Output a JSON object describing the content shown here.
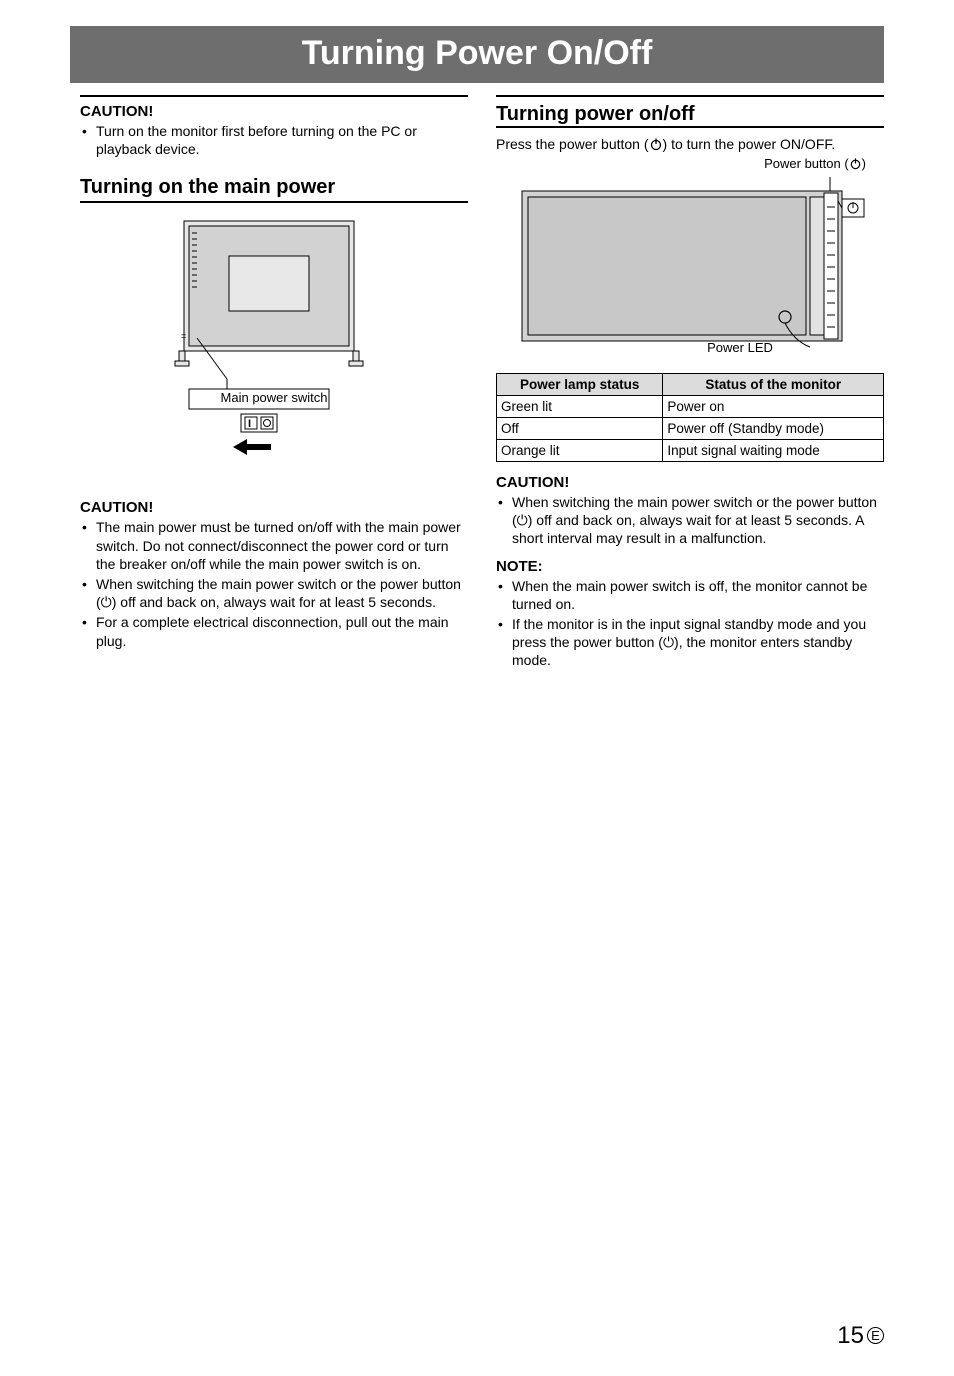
{
  "title": "Turning Power On/Off",
  "left": {
    "caution1_h": "CAUTION!",
    "caution1_items": [
      "Turn on the monitor first before turning on the PC or playback device."
    ],
    "section_h": "Turning on the main power",
    "fig_label": "Main power switch",
    "caution2_h": "CAUTION!",
    "caution2_items": [
      "The main power must be turned on/off with the main power switch. Do not connect/disconnect the power cord or turn the breaker on/off while the main power switch is on.",
      "When switching the main power switch or the power button (⏻) off and back on, always wait for at least 5 seconds.",
      "For a complete electrical disconnection, pull out the main plug."
    ]
  },
  "right": {
    "section_h": "Turning power on/off",
    "intro_a": "Press the power button (",
    "intro_b": ") to turn the power ON/OFF.",
    "fig_label_btn_a": "Power button (",
    "fig_label_btn_b": ")",
    "fig_label_led": "Power LED",
    "table_h1": "Power lamp status",
    "table_h2": "Status of the monitor",
    "rows": [
      {
        "a": "Green lit",
        "b": "Power on"
      },
      {
        "a": "Off",
        "b": "Power off (Standby mode)"
      },
      {
        "a": "Orange lit",
        "b": "Input signal waiting mode"
      }
    ],
    "caution_h": "CAUTION!",
    "caution_items": [
      "When switching the main power switch or the power button (⏻) off and back on, always wait for at least 5 seconds. A short interval may result in a malfunction."
    ],
    "note_h": "NOTE:",
    "note_items": [
      "When the main power switch is off, the monitor cannot be turned on.",
      "If the monitor is in the input signal standby mode and you press the power button (⏻), the monitor enters standby mode."
    ]
  },
  "page_num": "15",
  "page_badge": "E"
}
